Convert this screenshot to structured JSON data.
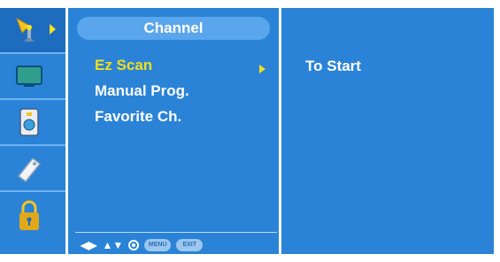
{
  "sidebar": {
    "items": [
      {
        "icon": "antenna-icon",
        "selected": true
      },
      {
        "icon": "picture-icon",
        "selected": false
      },
      {
        "icon": "timer-icon",
        "selected": false
      },
      {
        "icon": "option-tag-icon",
        "selected": false
      },
      {
        "icon": "lock-icon",
        "selected": false
      }
    ]
  },
  "menu": {
    "title": "Channel",
    "items": [
      {
        "label": "Ez Scan",
        "active": true
      },
      {
        "label": "Manual Prog.",
        "active": false
      },
      {
        "label": "Favorite Ch.",
        "active": false
      }
    ],
    "footer": {
      "lr_glyph": "◀▶",
      "ud_glyph": "▲▼",
      "menu_label": "MENU",
      "exit_label": "EXIT"
    }
  },
  "submenu": {
    "text": "To Start"
  },
  "colors": {
    "panel": "#2a83d6",
    "highlight": "#f0df1d",
    "text": "#ffffff"
  }
}
